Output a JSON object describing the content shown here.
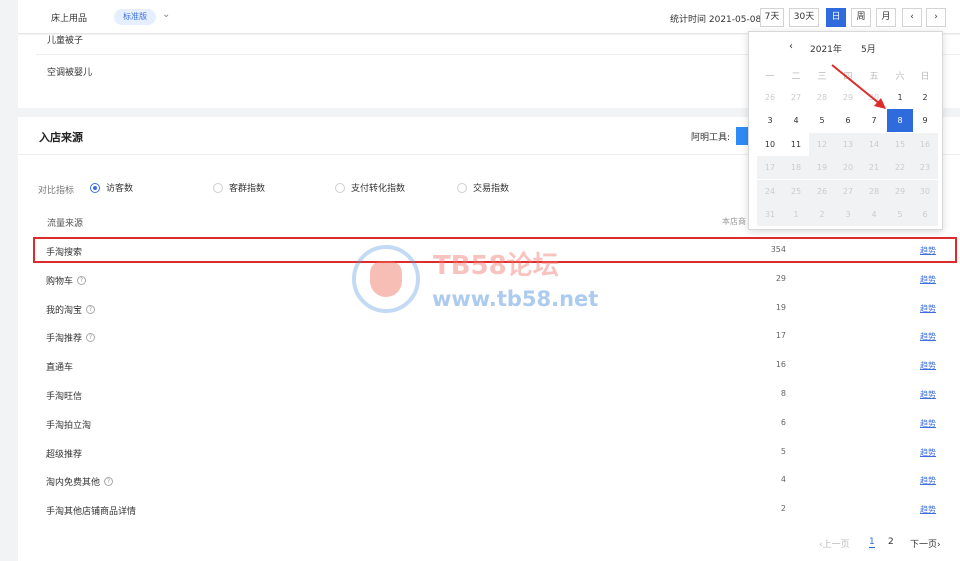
{
  "topbar": {
    "category": "床上用品",
    "edition_badge": "标准版",
    "stat_time_label": "统计时间 2021-05-08",
    "period_buttons": [
      "7天",
      "30天",
      "日",
      "周",
      "月"
    ],
    "active_period": "日",
    "prev_label": "‹",
    "next_label": "›"
  },
  "card1": {
    "rows": [
      "儿童被子",
      "空调被婴儿"
    ]
  },
  "traffic": {
    "title": "入店来源",
    "tool_label": "阿明工具:",
    "metric_label": "对比指标",
    "metrics": [
      "访客数",
      "客群指数",
      "支付转化指数",
      "交易指数"
    ],
    "selected_metric": "访客数",
    "col_source": "流量来源",
    "col_shop": "本店商",
    "trend_label": "趋势",
    "rows": [
      {
        "name": "手淘搜索",
        "value": "354",
        "help": false
      },
      {
        "name": "购物车",
        "value": "29",
        "help": true
      },
      {
        "name": "我的淘宝",
        "value": "19",
        "help": true
      },
      {
        "name": "手淘推荐",
        "value": "17",
        "help": true
      },
      {
        "name": "直通车",
        "value": "16",
        "help": false
      },
      {
        "name": "手淘旺信",
        "value": "8",
        "help": false
      },
      {
        "name": "手淘拍立淘",
        "value": "6",
        "help": false
      },
      {
        "name": "超级推荐",
        "value": "5",
        "help": false
      },
      {
        "name": "淘内免费其他",
        "value": "4",
        "help": true
      },
      {
        "name": "手淘其他店铺商品详情",
        "value": "2",
        "help": false
      }
    ],
    "pager": {
      "prev": "‹上一页",
      "pages": [
        "1",
        "2"
      ],
      "current": "1",
      "next": "下一页›"
    }
  },
  "watermark": {
    "line1": "TB58论坛",
    "line2": "www.tb58.net"
  },
  "picker": {
    "prev": "‹",
    "year": "2021年",
    "month": "5月",
    "weekdays": [
      "一",
      "二",
      "三",
      "四",
      "五",
      "六",
      "日"
    ],
    "weeks": [
      [
        "26",
        "27",
        "28",
        "29",
        "30",
        "1",
        "2"
      ],
      [
        "3",
        "4",
        "5",
        "6",
        "7",
        "8",
        "9"
      ],
      [
        "10",
        "11",
        "12",
        "13",
        "14",
        "15",
        "16"
      ],
      [
        "17",
        "18",
        "19",
        "20",
        "21",
        "22",
        "23"
      ],
      [
        "24",
        "25",
        "26",
        "27",
        "28",
        "29",
        "30"
      ],
      [
        "31",
        "1",
        "2",
        "3",
        "4",
        "5",
        "6"
      ]
    ],
    "selected": "8",
    "colors": {
      "selected": "#2f6bdc",
      "arrow": "#e02b2b"
    }
  }
}
